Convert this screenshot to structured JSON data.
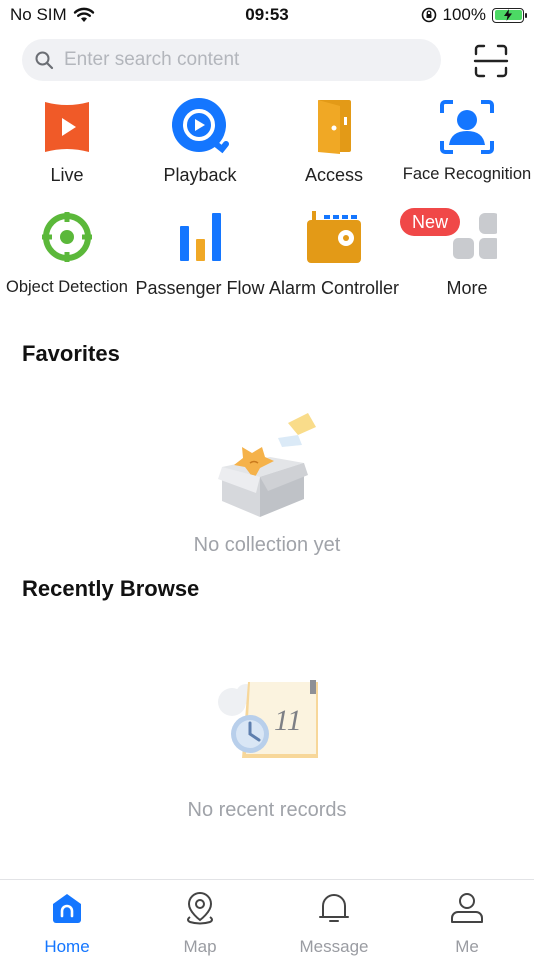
{
  "status": {
    "carrier": "No SIM",
    "time": "09:53",
    "battery": "100%",
    "battery_level": 1.0
  },
  "search": {
    "placeholder": "Enter search content"
  },
  "features": [
    {
      "label": "Live",
      "icon": "live-icon"
    },
    {
      "label": "Playback",
      "icon": "playback-icon"
    },
    {
      "label": "Access",
      "icon": "access-door-icon"
    },
    {
      "label": "Face Recognition",
      "icon": "face-recognition-icon"
    },
    {
      "label": "Object Detection",
      "icon": "object-detection-icon"
    },
    {
      "label": "Passenger Flow",
      "icon": "passenger-flow-icon"
    },
    {
      "label": "Alarm Controller",
      "icon": "alarm-controller-icon"
    },
    {
      "label": "More",
      "icon": "more-grid-icon",
      "badge": "New"
    }
  ],
  "favorites": {
    "title": "Favorites",
    "empty": "No collection yet"
  },
  "recent": {
    "title": "Recently Browse",
    "empty": "No recent records",
    "calendar_day": "11"
  },
  "tabs": [
    {
      "label": "Home",
      "active": true
    },
    {
      "label": "Map",
      "active": false
    },
    {
      "label": "Message",
      "active": false
    },
    {
      "label": "Me",
      "active": false
    }
  ],
  "colors": {
    "accent": "#1476ff",
    "live": "#f05a28",
    "access": "#e39a17",
    "detect": "#5bb83a",
    "badge": "#f04848"
  }
}
